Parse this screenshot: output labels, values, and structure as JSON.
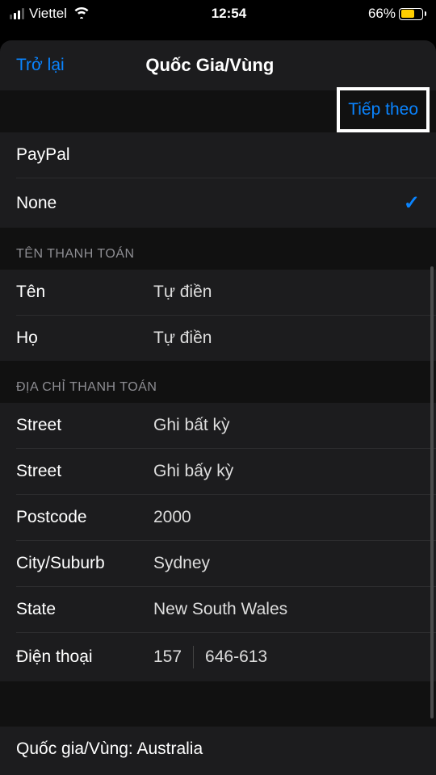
{
  "status": {
    "carrier": "Viettel",
    "time": "12:54",
    "battery": "66%"
  },
  "nav": {
    "back": "Trở lại",
    "title": "Quốc Gia/Vùng",
    "next": "Tiếp theo"
  },
  "payment_methods": {
    "paypal": "PayPal",
    "none": "None"
  },
  "billing_name": {
    "header": "TÊN THANH TOÁN",
    "first_label": "Tên",
    "first_value": "Tự điền",
    "last_label": "Họ",
    "last_value": "Tự điền"
  },
  "billing_address": {
    "header": "ĐỊA CHỈ THANH TOÁN",
    "street1_label": "Street",
    "street1_value": "Ghi bất kỳ",
    "street2_label": "Street",
    "street2_value": "Ghi bấy kỳ",
    "postcode_label": "Postcode",
    "postcode_value": "2000",
    "city_label": "City/Suburb",
    "city_value": "Sydney",
    "state_label": "State",
    "state_value": "New South Wales",
    "phone_label": "Điện thoại",
    "phone_prefix": "157",
    "phone_number": "646-613"
  },
  "country_region": "Quốc gia/Vùng: Australia"
}
